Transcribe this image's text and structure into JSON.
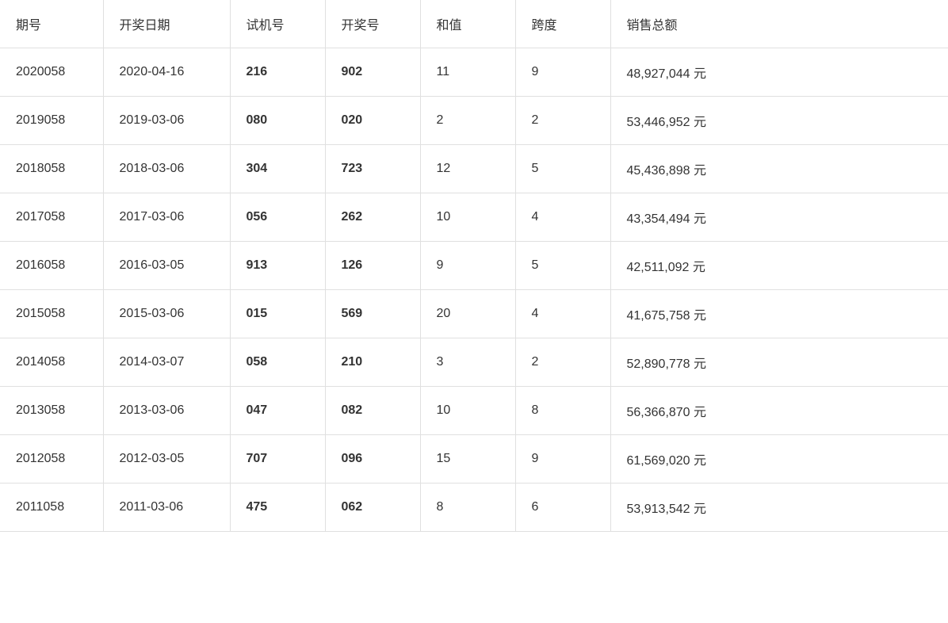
{
  "table": {
    "columns": [
      {
        "key": "qihao",
        "label": "期号"
      },
      {
        "key": "date",
        "label": "开奖日期"
      },
      {
        "key": "shiji",
        "label": "试机号"
      },
      {
        "key": "kaijang",
        "label": "开奖号"
      },
      {
        "key": "hezhi",
        "label": "和值"
      },
      {
        "key": "kuadu",
        "label": "跨度"
      },
      {
        "key": "sales",
        "label": "销售总额"
      }
    ],
    "rows": [
      {
        "qihao": "2020058",
        "date": "2020-04-16",
        "shiji": "216",
        "kaijang": "902",
        "hezhi": "11",
        "kuadu": "9",
        "sales": "48,927,044 元"
      },
      {
        "qihao": "2019058",
        "date": "2019-03-06",
        "shiji": "080",
        "kaijang": "020",
        "hezhi": "2",
        "kuadu": "2",
        "sales": "53,446,952 元"
      },
      {
        "qihao": "2018058",
        "date": "2018-03-06",
        "shiji": "304",
        "kaijang": "723",
        "hezhi": "12",
        "kuadu": "5",
        "sales": "45,436,898 元"
      },
      {
        "qihao": "2017058",
        "date": "2017-03-06",
        "shiji": "056",
        "kaijang": "262",
        "hezhi": "10",
        "kuadu": "4",
        "sales": "43,354,494 元"
      },
      {
        "qihao": "2016058",
        "date": "2016-03-05",
        "shiji": "913",
        "kaijang": "126",
        "hezhi": "9",
        "kuadu": "5",
        "sales": "42,511,092 元"
      },
      {
        "qihao": "2015058",
        "date": "2015-03-06",
        "shiji": "015",
        "kaijang": "569",
        "hezhi": "20",
        "kuadu": "4",
        "sales": "41,675,758 元"
      },
      {
        "qihao": "2014058",
        "date": "2014-03-07",
        "shiji": "058",
        "kaijang": "210",
        "hezhi": "3",
        "kuadu": "2",
        "sales": "52,890,778 元"
      },
      {
        "qihao": "2013058",
        "date": "2013-03-06",
        "shiji": "047",
        "kaijang": "082",
        "hezhi": "10",
        "kuadu": "8",
        "sales": "56,366,870 元"
      },
      {
        "qihao": "2012058",
        "date": "2012-03-05",
        "shiji": "707",
        "kaijang": "096",
        "hezhi": "15",
        "kuadu": "9",
        "sales": "61,569,020 元"
      },
      {
        "qihao": "2011058",
        "date": "2011-03-06",
        "shiji": "475",
        "kaijang": "062",
        "hezhi": "8",
        "kuadu": "6",
        "sales": "53,913,542 元"
      }
    ]
  }
}
